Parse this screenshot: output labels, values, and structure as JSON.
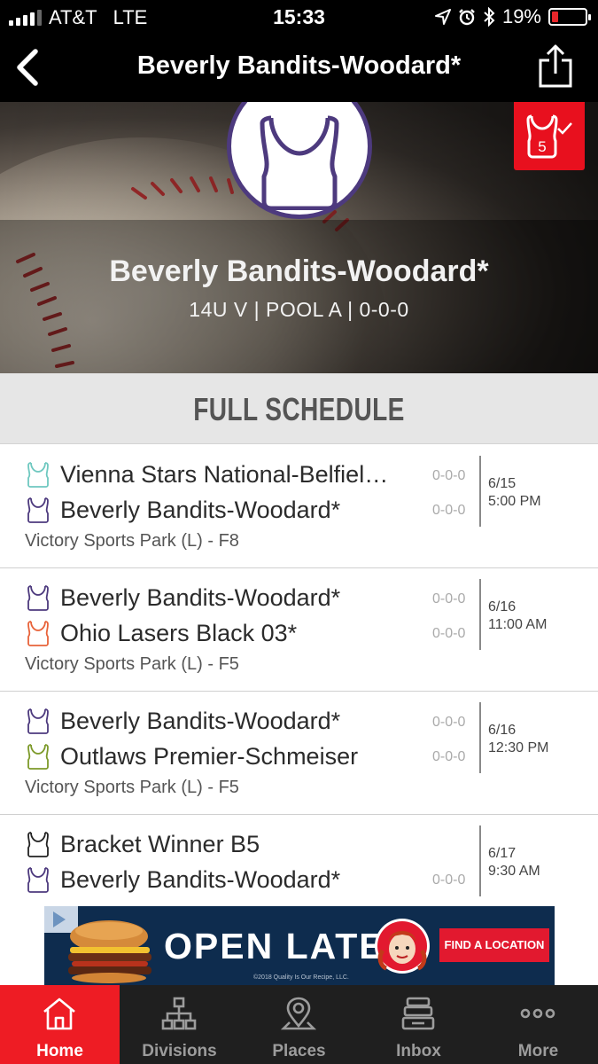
{
  "status_bar": {
    "carrier": "AT&T",
    "network": "LTE",
    "time": "15:33",
    "battery": "19%",
    "battery_level": 0.19
  },
  "nav": {
    "title": "Beverly Bandits-Woodard*",
    "back_icon": "chevron-left-icon",
    "share_icon": "share-icon"
  },
  "hero": {
    "team_name": "Beverly Bandits-Woodard*",
    "team_sub": "14U V | POOL A | 0-0-0",
    "favorite_count": "5"
  },
  "schedule": {
    "header": "FULL SCHEDULE",
    "games": [
      {
        "home": {
          "name": "Vienna Stars National-Belfield",
          "display": "Vienna Stars National-Belfiel…",
          "score": "0-0-0",
          "color": "#6fc8c0"
        },
        "away": {
          "name": "Beverly Bandits-Woodard*",
          "display": "Beverly Bandits-Woodard*",
          "score": "0-0-0",
          "color": "#4d3a7e"
        },
        "date": "6/15",
        "time": "5:00 PM",
        "venue": "Victory Sports Park (L) - F8"
      },
      {
        "home": {
          "name": "Beverly Bandits-Woodard*",
          "display": "Beverly Bandits-Woodard*",
          "score": "0-0-0",
          "color": "#4d3a7e"
        },
        "away": {
          "name": "Ohio Lasers Black 03*",
          "display": "Ohio Lasers Black 03*",
          "score": "0-0-0",
          "color": "#e8633a"
        },
        "date": "6/16",
        "time": "11:00 AM",
        "venue": "Victory Sports Park (L) - F5"
      },
      {
        "home": {
          "name": "Beverly Bandits-Woodard*",
          "display": "Beverly Bandits-Woodard*",
          "score": "0-0-0",
          "color": "#4d3a7e"
        },
        "away": {
          "name": "Outlaws Premier-Schmeiser",
          "display": "Outlaws Premier-Schmeiser",
          "score": "0-0-0",
          "color": "#7d9a2a"
        },
        "date": "6/16",
        "time": "12:30 PM",
        "venue": "Victory Sports Park (L) - F5"
      },
      {
        "home": {
          "name": "Bracket Winner B5",
          "display": "Bracket Winner B5",
          "score": "",
          "color": "#222222"
        },
        "away": {
          "name": "Beverly Bandits-Woodard*",
          "display": "Beverly Bandits-Woodard*",
          "score": "0-0-0",
          "color": "#4d3a7e"
        },
        "date": "6/17",
        "time": "9:30 AM",
        "venue": ""
      }
    ]
  },
  "ad": {
    "headline": "OPEN LATE",
    "cta": "FIND A LOCATION",
    "legal": "©2018 Quality Is Our Recipe, LLC."
  },
  "tabs": [
    {
      "label": "Home",
      "icon": "home-icon",
      "active": true
    },
    {
      "label": "Divisions",
      "icon": "divisions-icon",
      "active": false
    },
    {
      "label": "Places",
      "icon": "location-pin-icon",
      "active": false
    },
    {
      "label": "Inbox",
      "icon": "inbox-icon",
      "active": false
    },
    {
      "label": "More",
      "icon": "more-dots-icon",
      "active": false
    }
  ],
  "colors": {
    "accent": "#ee1c24",
    "team_purple": "#4d3a7e",
    "bar_black": "#000000"
  }
}
